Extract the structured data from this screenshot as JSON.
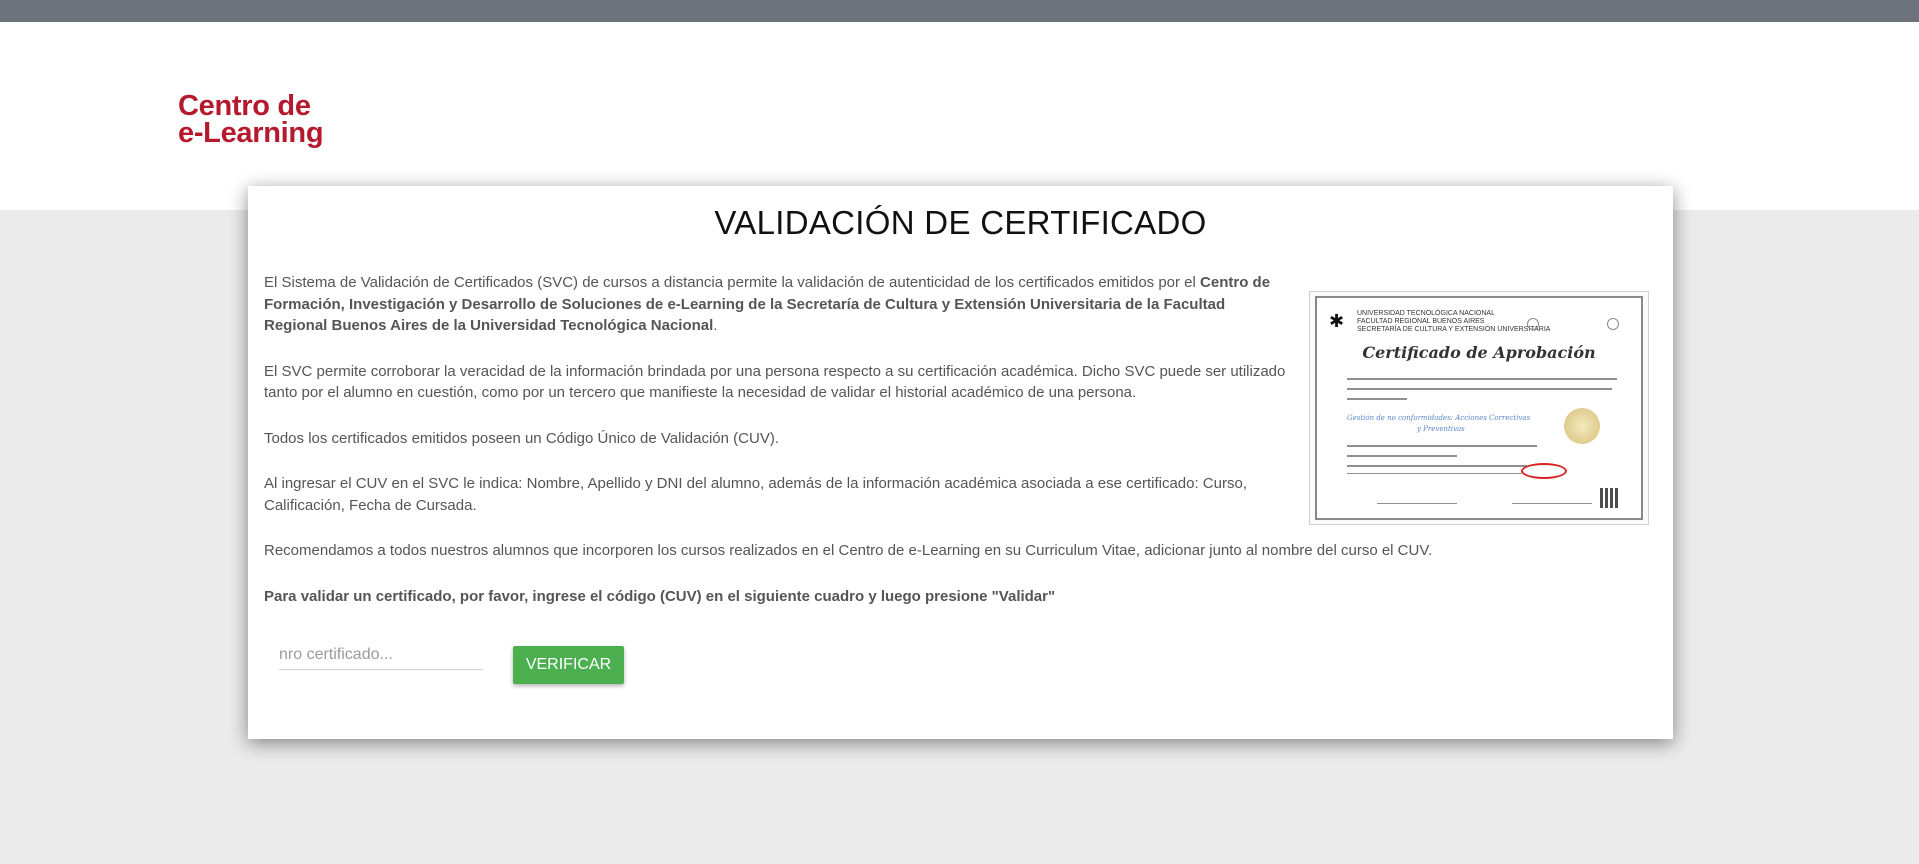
{
  "header": {
    "logo_line1": "Centro de",
    "logo_line2": "e-Learning",
    "brand_color": "#b5192e"
  },
  "card": {
    "title": "VALIDACIÓN DE CERTIFICADO",
    "p1_text": "El Sistema de Validación de Certificados (SVC) de cursos a distancia permite la validación de autenticidad de los certificados emitidos por el ",
    "p1_bold": "Centro de Formación, Investigación y Desarrollo de Soluciones de e-Learning de la Secretaría de Cultura y Extensión Universitaria de la Facultad Regional Buenos Aires de la Universidad Tecnológica Nacional",
    "p1_end": ".",
    "p2": "El SVC permite corroborar la veracidad de la información brindada por una persona respecto a su certificación académica. Dicho SVC puede ser utilizado tanto por el alumno en cuestión, como por un tercero que manifieste la necesidad de validar el historial académico de una persona.",
    "p3": "Todos los certificados emitidos poseen un Código Único de Validación (CUV).",
    "p4": "Al ingresar el CUV en el SVC le indica: Nombre, Apellido y DNI del alumno, además de la información académica asociada a ese certificado: Curso, Calificación, Fecha de Cursada.",
    "p5": "Recomendamos a todos nuestros alumnos que incorporen los cursos realizados en el Centro de e-Learning en su Curriculum Vitae, adicionar junto al nombre del curso el CUV.",
    "p6": "Para validar un certificado, por favor, ingrese el código (CUV) en el siguiente cuadro y luego presione \"Validar\""
  },
  "certificate_image": {
    "uni_line1": "UNIVERSIDAD TECNOLÓGICA NACIONAL",
    "uni_line2": "FACULTAD REGIONAL BUENOS AIRES",
    "uni_line3": "SECRETARÍA DE CULTURA Y EXTENSIÓN UNIVERSITARIA",
    "heading": "Certificado de Aprobación",
    "course_line1": "Gestión de no conformidades: Acciones Correctivas",
    "course_line2": "y Preventivas"
  },
  "form": {
    "input_placeholder": "nro certificado...",
    "input_value": "",
    "button_label": "VERIFICAR",
    "button_color": "#4caf50"
  }
}
